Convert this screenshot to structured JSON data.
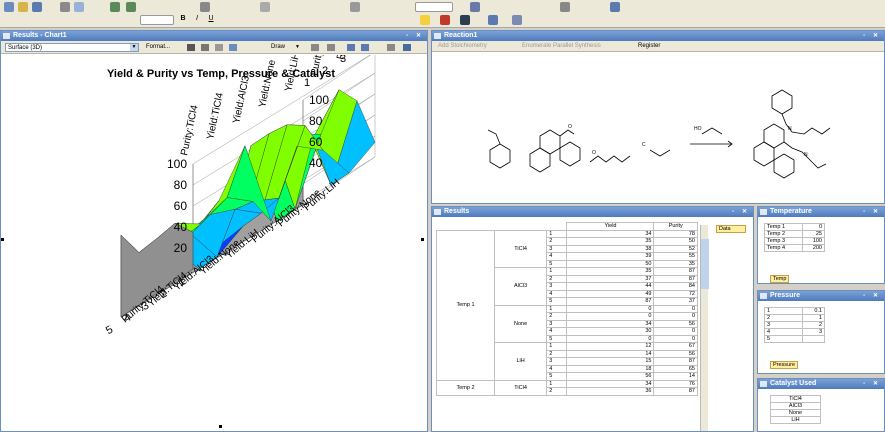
{
  "chart_window": {
    "title": "Results - Chart1",
    "chart_type_select": "Surface (3D)",
    "format_label": "Format...",
    "draw_label": "Draw"
  },
  "chart_data": {
    "type": "surface3d",
    "title": "Yield & Purity vs Temp, Pressure & Catalyst",
    "z_ticks": [
      "20",
      "40",
      "60",
      "80",
      "100"
    ],
    "z_ticks_right": [
      "40",
      "60",
      "80",
      "100"
    ],
    "depth_ticks": [
      "1",
      "2",
      "3",
      "4",
      "5"
    ],
    "depth_ticks_back": [
      "1",
      "2",
      "3",
      "4"
    ],
    "series_front": [
      "Purity:TiCl4",
      "Yield:TiCl4",
      "Yield:AlCl3",
      "Yield:None",
      "Yield:LiH",
      "Purity:AlCl3",
      "Purity:None",
      "Purity:LiH"
    ],
    "series_back": [
      "Purity:TiCl4",
      "Yield:TiCl4",
      "Yield:AlCl3",
      "Yield:None",
      "Yield:LiH",
      "Purity:AlCl3",
      "Purity:None",
      "Purity:LiH"
    ],
    "z_range": [
      0,
      100
    ]
  },
  "reaction_window": {
    "title": "Reaction1",
    "add_stoichiometry": "Add Stoichiometry",
    "enumerate": "Enumerate Parallel Synthesis",
    "register": "Register",
    "arrow_label": "HO"
  },
  "results_window": {
    "title": "Results",
    "headers": [
      "Yield",
      "Purity"
    ],
    "data_tag": "Data",
    "groups": [
      {
        "temp": "Temp 1",
        "catalysts": [
          {
            "name": "TiCl4",
            "rows": [
              [
                "1",
                "34",
                "78"
              ],
              [
                "2",
                "35",
                "50"
              ],
              [
                "3",
                "38",
                "52"
              ],
              [
                "4",
                "39",
                "55"
              ],
              [
                "5",
                "50",
                "35"
              ]
            ]
          },
          {
            "name": "AlCl3",
            "rows": [
              [
                "1",
                "35",
                "87"
              ],
              [
                "2",
                "37",
                "87"
              ],
              [
                "3",
                "44",
                "84"
              ],
              [
                "4",
                "49",
                "72"
              ],
              [
                "5",
                "87",
                "37"
              ]
            ]
          },
          {
            "name": "None",
            "rows": [
              [
                "1",
                "0",
                "0"
              ],
              [
                "2",
                "0",
                "0"
              ],
              [
                "3",
                "34",
                "56"
              ],
              [
                "4",
                "30",
                "0"
              ],
              [
                "5",
                "0",
                "0"
              ]
            ]
          },
          {
            "name": "LiH",
            "rows": [
              [
                "1",
                "12",
                "67"
              ],
              [
                "2",
                "14",
                "56"
              ],
              [
                "3",
                "15",
                "87"
              ],
              [
                "4",
                "18",
                "65"
              ],
              [
                "5",
                "56",
                "14"
              ]
            ]
          }
        ]
      },
      {
        "temp": "Temp 2",
        "catalysts": [
          {
            "name": "TiCl4",
            "rows": [
              [
                "1",
                "34",
                "76"
              ],
              [
                "2",
                "36",
                "87"
              ]
            ]
          }
        ]
      }
    ]
  },
  "temperature_window": {
    "title": "Temperature",
    "rows": [
      [
        "Temp 1",
        "0"
      ],
      [
        "Temp 2",
        "25"
      ],
      [
        "Temp 3",
        "100"
      ],
      [
        "Temp 4",
        "200"
      ]
    ],
    "tag": "Temp"
  },
  "pressure_window": {
    "title": "Pressure",
    "rows": [
      [
        "1",
        "0.1"
      ],
      [
        "2",
        "1"
      ],
      [
        "3",
        "2"
      ],
      [
        "4",
        "3"
      ],
      [
        "5",
        ""
      ]
    ],
    "tag": "Pressure"
  },
  "catalyst_window": {
    "title": "Catalyst Used",
    "rows": [
      "TiCl4",
      "AlCl3",
      "None",
      "LiH"
    ]
  },
  "colors": {
    "title_blue": "#4f7bbd",
    "toolbar": "#ece9d8"
  }
}
